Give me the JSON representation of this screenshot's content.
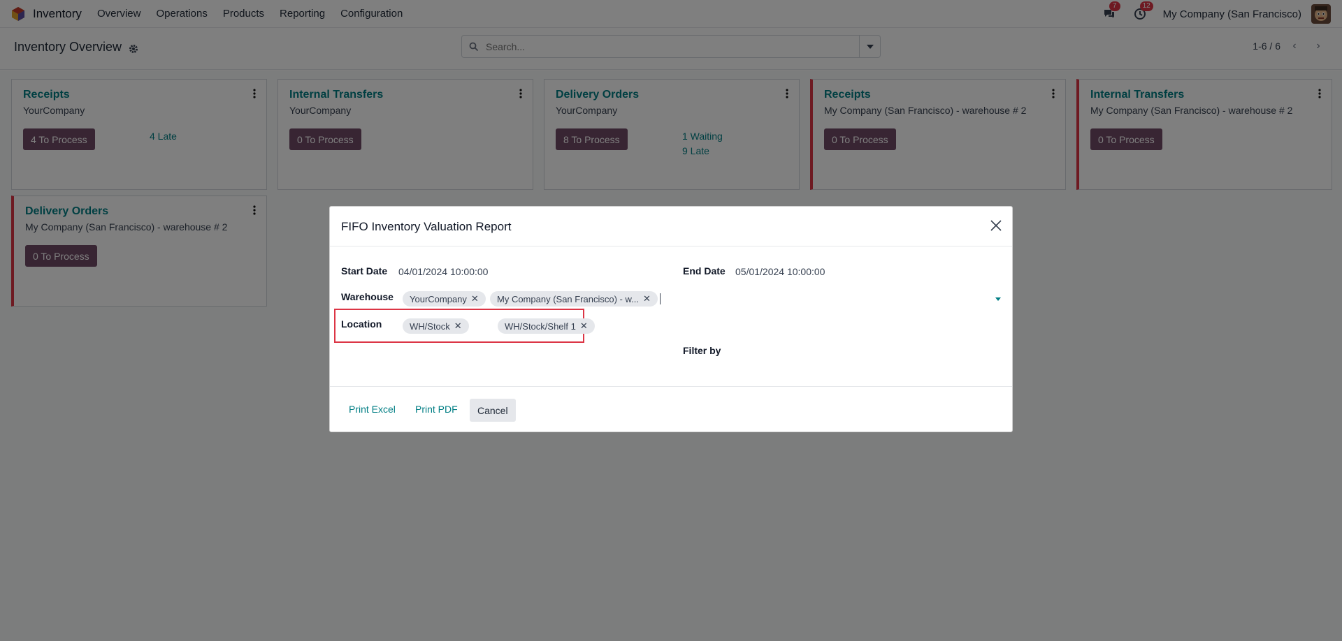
{
  "navbar": {
    "app_name": "Inventory",
    "menu": [
      "Overview",
      "Operations",
      "Products",
      "Reporting",
      "Configuration"
    ],
    "messages_count": "7",
    "activities_count": "12",
    "company": "My Company (San Francisco)"
  },
  "control_panel": {
    "title": "Inventory Overview",
    "search_placeholder": "Search...",
    "pager": "1-6 / 6"
  },
  "cards": [
    {
      "title": "Receipts",
      "subtitle": "YourCompany",
      "button": "4 To Process",
      "links": [
        "4 Late"
      ],
      "warning": false
    },
    {
      "title": "Internal Transfers",
      "subtitle": "YourCompany",
      "button": "0 To Process",
      "links": [],
      "warning": false
    },
    {
      "title": "Delivery Orders",
      "subtitle": "YourCompany",
      "button": "8 To Process",
      "links": [
        "1 Waiting",
        "9 Late"
      ],
      "warning": false
    },
    {
      "title": "Receipts",
      "subtitle": "My Company (San Francisco) - warehouse # 2",
      "button": "0 To Process",
      "links": [],
      "warning": true
    },
    {
      "title": "Internal Transfers",
      "subtitle": "My Company (San Francisco) - warehouse # 2",
      "button": "0 To Process",
      "links": [],
      "warning": true
    },
    {
      "title": "Delivery Orders",
      "subtitle": "My Company (San Francisco) - warehouse # 2",
      "button": "0 To Process",
      "links": [],
      "warning": true
    }
  ],
  "dialog": {
    "title": "FIFO Inventory Valuation Report",
    "start_date_label": "Start Date",
    "start_date": "04/01/2024 10:00:00",
    "end_date_label": "End Date",
    "end_date": "05/01/2024 10:00:00",
    "warehouse_label": "Warehouse",
    "warehouse_tags": [
      "YourCompany",
      "My Company (San Francisco) - w..."
    ],
    "location_label": "Location",
    "location_tags": [
      "WH/Stock",
      "WH/Stock/Shelf 1"
    ],
    "filter_by_label": "Filter by",
    "print_excel": "Print Excel",
    "print_pdf": "Print PDF",
    "cancel": "Cancel"
  },
  "colors": {
    "accent": "#017e84",
    "primary_button": "#714b67",
    "warning": "#dc3545"
  }
}
